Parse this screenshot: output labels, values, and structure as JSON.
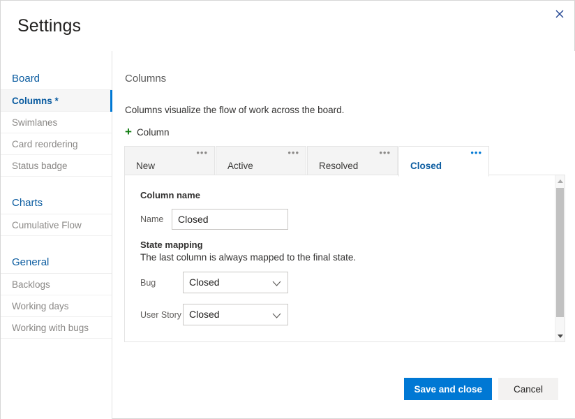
{
  "dialog": {
    "title": "Settings",
    "close_icon": "close-icon"
  },
  "sidebar": {
    "groups": [
      {
        "title": "Board",
        "items": [
          {
            "label": "Columns *",
            "selected": true
          },
          {
            "label": "Swimlanes",
            "selected": false
          },
          {
            "label": "Card reordering",
            "selected": false
          },
          {
            "label": "Status badge",
            "selected": false
          }
        ]
      },
      {
        "title": "Charts",
        "items": [
          {
            "label": "Cumulative Flow",
            "selected": false
          }
        ]
      },
      {
        "title": "General",
        "items": [
          {
            "label": "Backlogs",
            "selected": false
          },
          {
            "label": "Working days",
            "selected": false
          },
          {
            "label": "Working with bugs",
            "selected": false
          }
        ]
      }
    ]
  },
  "main": {
    "section_title": "Columns",
    "description": "Columns visualize the flow of work across the board.",
    "add_column_label": "Column",
    "add_column_icon": "plus-icon",
    "tabs": [
      {
        "label": "New",
        "active": false,
        "menu_icon": "ellipsis-icon",
        "menu_glyph": "•••"
      },
      {
        "label": "Active",
        "active": false,
        "menu_icon": "ellipsis-icon",
        "menu_glyph": "•••"
      },
      {
        "label": "Resolved",
        "active": false,
        "menu_icon": "ellipsis-icon",
        "menu_glyph": "•••"
      },
      {
        "label": "Closed",
        "active": true,
        "menu_icon": "ellipsis-icon",
        "menu_glyph": "•••"
      }
    ],
    "panel": {
      "column_name_heading": "Column name",
      "name_label": "Name",
      "name_value": "Closed",
      "name_placeholder": "",
      "state_mapping_heading": "State mapping",
      "state_mapping_note": "The last column is always mapped to the final state.",
      "mappings": [
        {
          "label": "Bug",
          "value": "Closed"
        },
        {
          "label": "User Story",
          "value": "Closed"
        }
      ],
      "chevron_icon": "chevron-down-icon"
    },
    "scrollbar": {
      "up_icon": "scroll-up-arrow-icon",
      "down_icon": "scroll-down-arrow-icon"
    }
  },
  "footer": {
    "primary_label": "Save and close",
    "secondary_label": "Cancel"
  },
  "colors": {
    "accent": "#0078d4",
    "link": "#0b5ca0",
    "plus_green": "#107c10",
    "muted_text": "#8a8886",
    "panel_border": "#e4e4e4"
  }
}
